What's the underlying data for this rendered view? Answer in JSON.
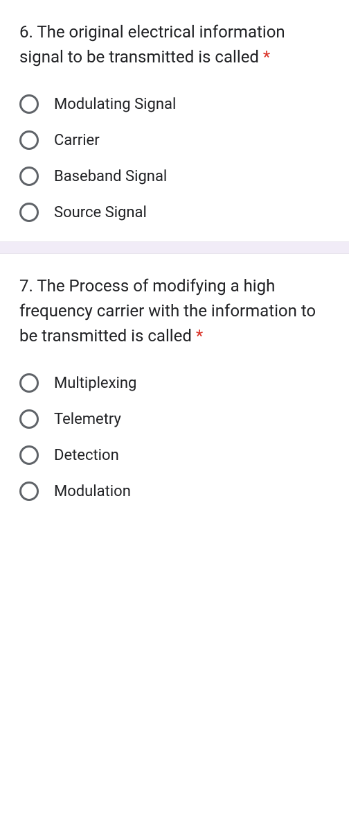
{
  "questions": [
    {
      "number": "6.",
      "text": "The original electrical information signal to be transmitted is called",
      "required": "*",
      "options": [
        "Modulating Signal",
        "Carrier",
        "Baseband Signal",
        "Source Signal"
      ]
    },
    {
      "number": "7.",
      "text": "The Process of modifying a high frequency carrier with the information to be transmitted is called",
      "required": "*",
      "options": [
        "Multiplexing",
        "Telemetry",
        "Detection",
        "Modulation"
      ]
    }
  ]
}
